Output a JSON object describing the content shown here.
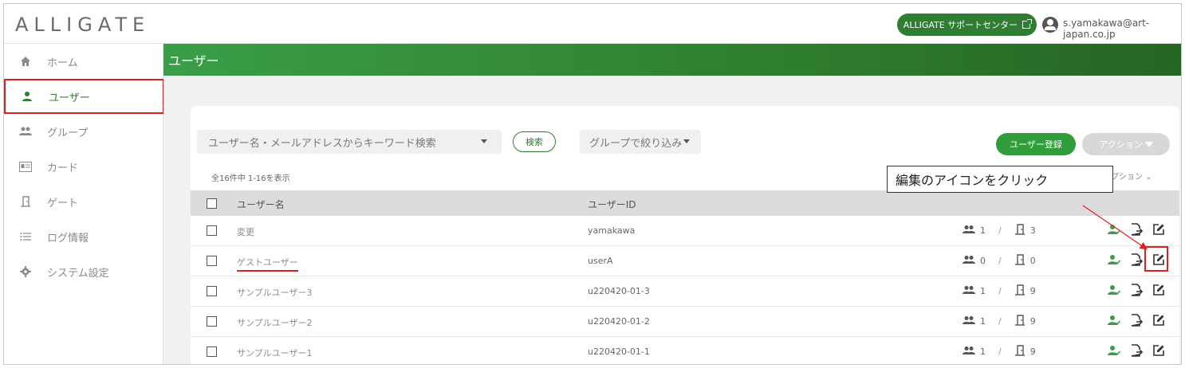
{
  "header": {
    "logo": "ALLIGATE",
    "support_label": "ALLIGATE サポートセンター",
    "user_email": "s.yamakawa@art-japan.co.jp"
  },
  "sidebar": {
    "items": [
      {
        "label": "ホーム",
        "icon": "home-icon"
      },
      {
        "label": "ユーザー",
        "icon": "user-icon",
        "active": true
      },
      {
        "label": "グループ",
        "icon": "group-icon"
      },
      {
        "label": "カード",
        "icon": "card-icon"
      },
      {
        "label": "ゲート",
        "icon": "gate-icon"
      },
      {
        "label": "ログ情報",
        "icon": "list-icon"
      },
      {
        "label": "システム設定",
        "icon": "gear-icon"
      }
    ]
  },
  "page": {
    "title": "ユーザー",
    "search_placeholder": "ユーザー名・メールアドレスからキーワード検索",
    "search_button": "検索",
    "group_filter": "グループで絞り込み",
    "register_button": "ユーザー登録",
    "action_button": "アクション",
    "count_text": "全16件中 1-16を表示",
    "options_text": "プション",
    "columns": {
      "name": "ユーザー名",
      "id": "ユーザーID"
    }
  },
  "rows": [
    {
      "name": "変更",
      "id": "yamakawa",
      "groups": "1",
      "gates": "3"
    },
    {
      "name": "ゲストユーザー",
      "id": "userA",
      "groups": "0",
      "gates": "0"
    },
    {
      "name": "サンプルユーザー3",
      "id": "u220420-01-3",
      "groups": "1",
      "gates": "9"
    },
    {
      "name": "サンプルユーザー2",
      "id": "u220420-01-2",
      "groups": "1",
      "gates": "9"
    },
    {
      "name": "サンプルユーザー1",
      "id": "u220420-01-1",
      "groups": "1",
      "gates": "9"
    }
  ],
  "annotation": {
    "callout": "編集のアイコンをクリック"
  },
  "colors": {
    "brand_green": "#2e7d32",
    "highlight_red": "#e02020"
  }
}
